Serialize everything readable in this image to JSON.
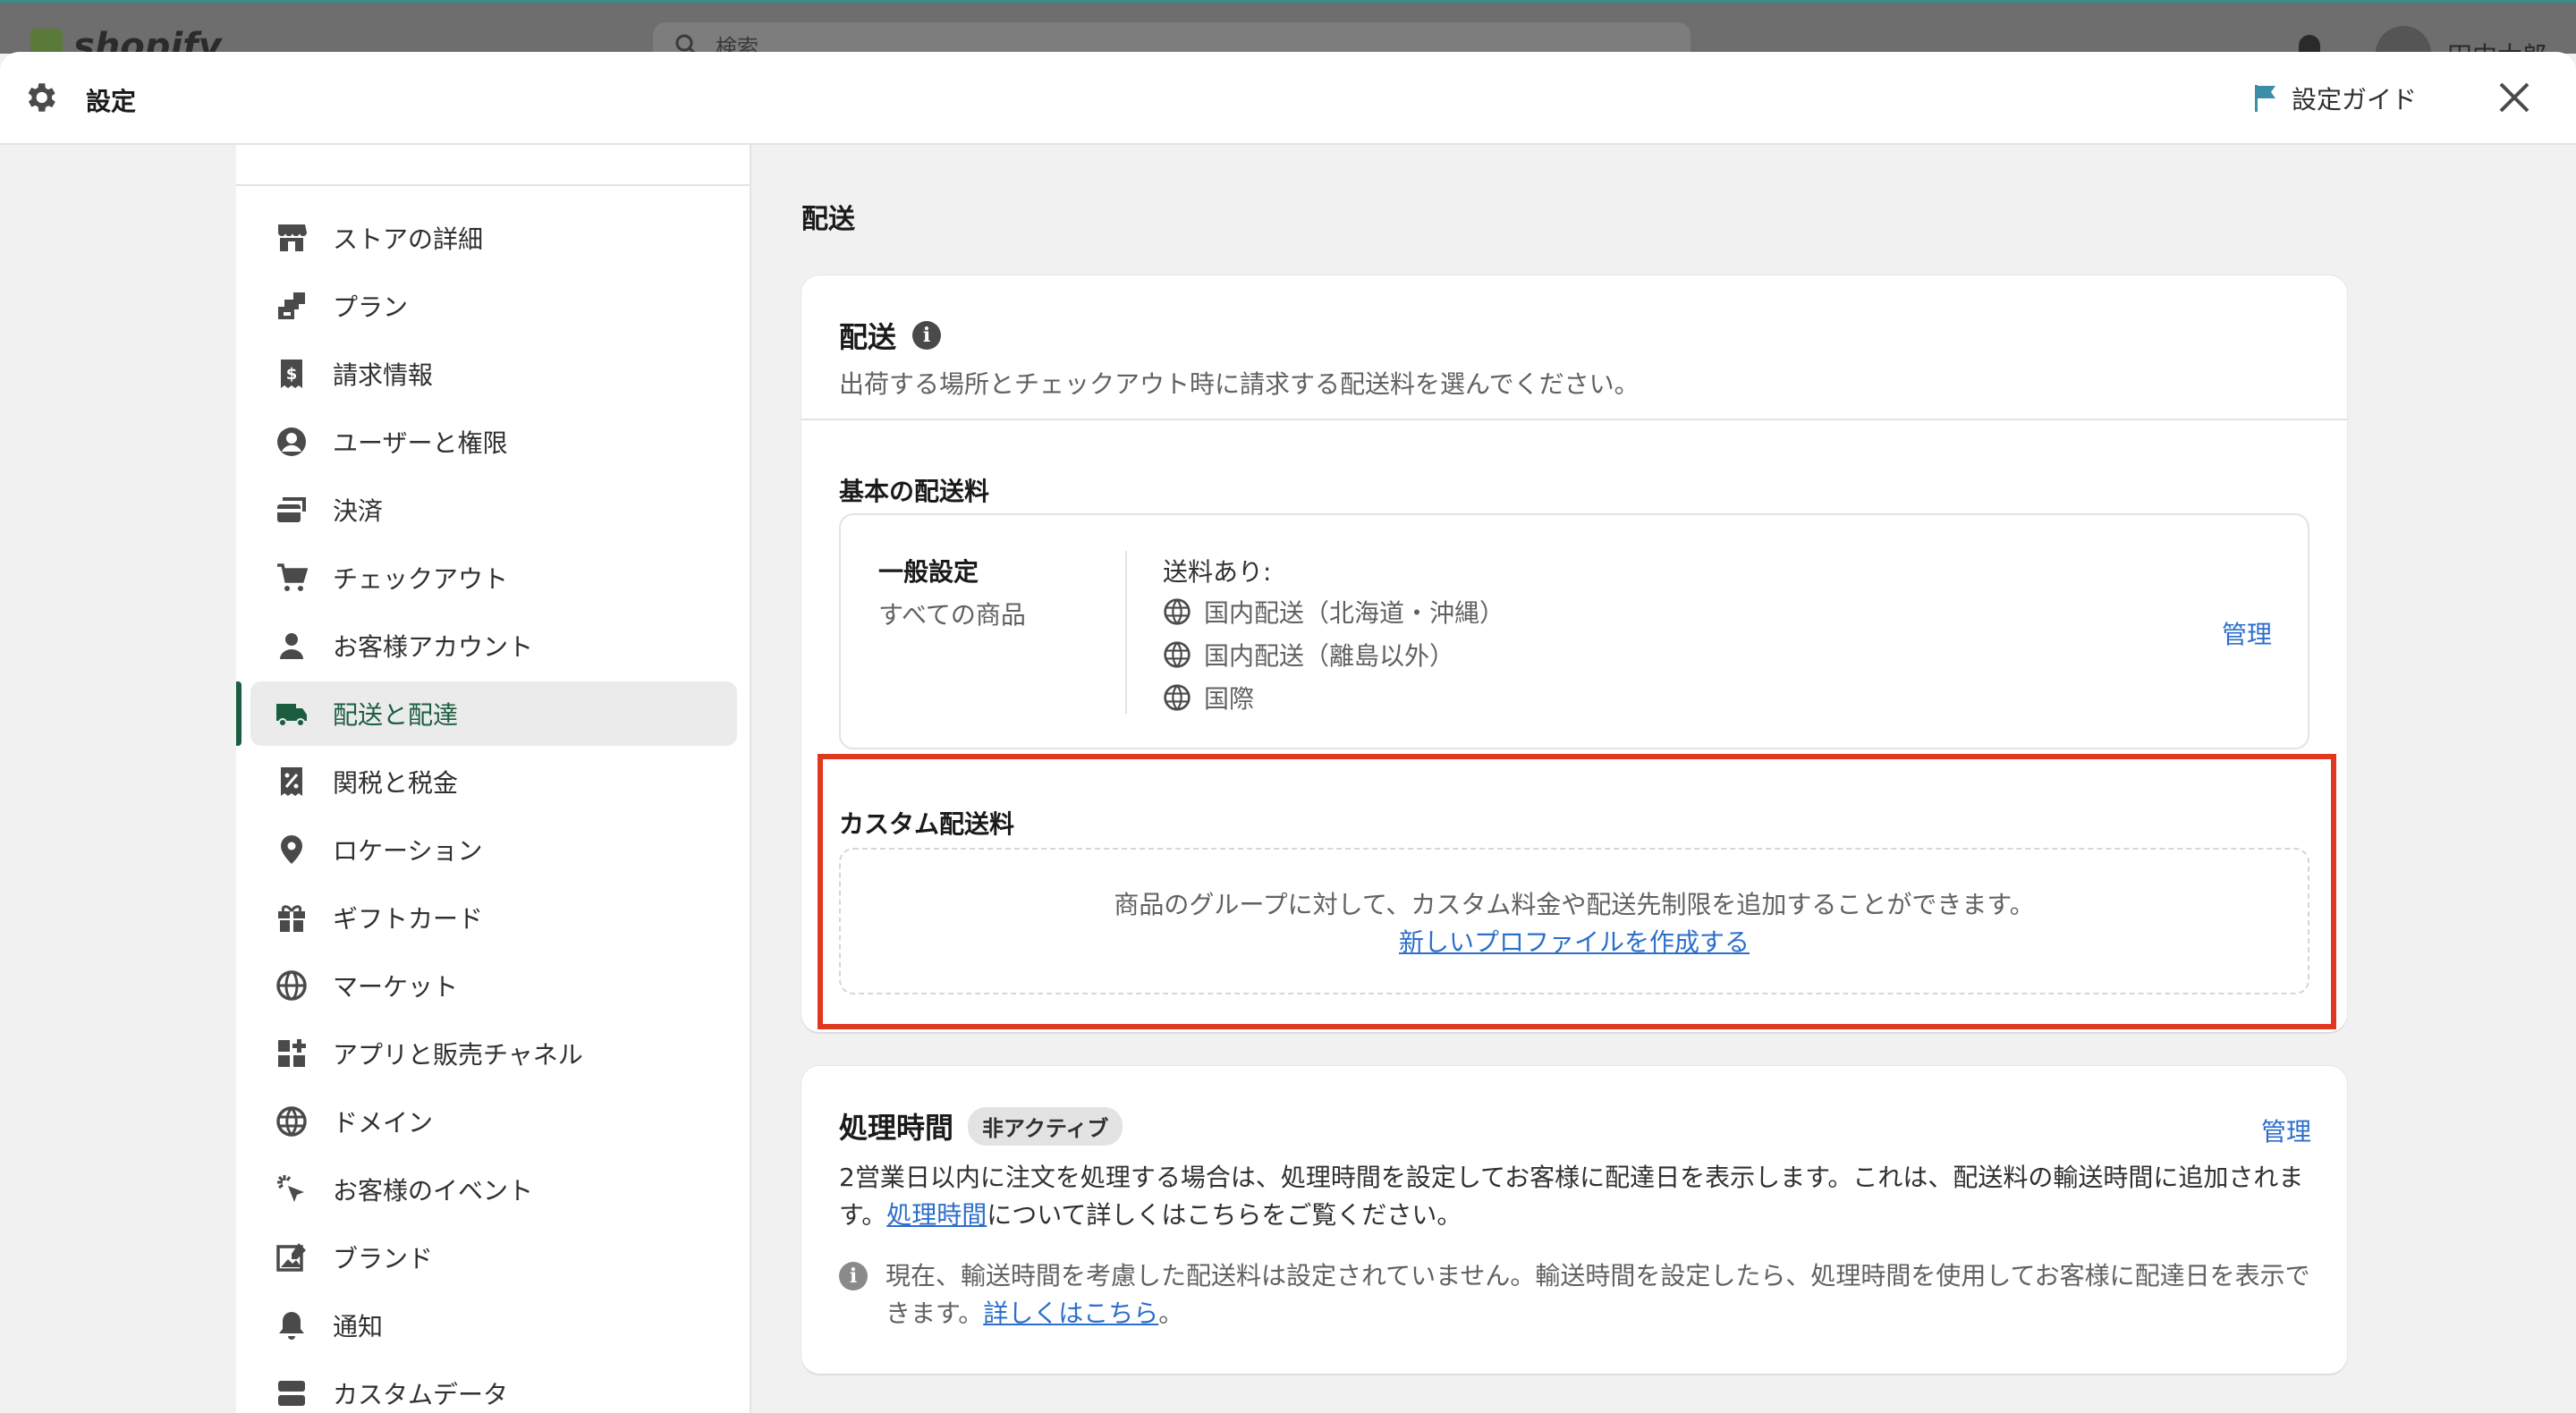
{
  "background": {
    "brand": "shopify",
    "search_placeholder": "検索",
    "user_name": "田中太郎"
  },
  "header": {
    "title": "設定",
    "guide_label": "設定ガイド",
    "icons": {
      "settings": "gear-icon",
      "guide": "flag-icon",
      "close": "close-icon"
    }
  },
  "sidebar": {
    "items": [
      {
        "label": "ストアの詳細",
        "icon": "store-icon"
      },
      {
        "label": "プラン",
        "icon": "plan-icon"
      },
      {
        "label": "請求情報",
        "icon": "billing-icon"
      },
      {
        "label": "ユーザーと権限",
        "icon": "user-circle-icon"
      },
      {
        "label": "決済",
        "icon": "payments-icon"
      },
      {
        "label": "チェックアウト",
        "icon": "cart-icon"
      },
      {
        "label": "お客様アカウント",
        "icon": "person-icon"
      },
      {
        "label": "配送と配達",
        "icon": "truck-icon",
        "active": true
      },
      {
        "label": "関税と税金",
        "icon": "tax-icon"
      },
      {
        "label": "ロケーション",
        "icon": "location-pin-icon"
      },
      {
        "label": "ギフトカード",
        "icon": "gift-icon"
      },
      {
        "label": "マーケット",
        "icon": "globe-market-icon"
      },
      {
        "label": "アプリと販売チャネル",
        "icon": "apps-icon"
      },
      {
        "label": "ドメイン",
        "icon": "globe-icon"
      },
      {
        "label": "お客様のイベント",
        "icon": "cursor-click-icon"
      },
      {
        "label": "ブランド",
        "icon": "brand-icon"
      },
      {
        "label": "通知",
        "icon": "bell-icon"
      },
      {
        "label": "カスタムデータ",
        "icon": "database-icon"
      }
    ]
  },
  "main": {
    "page_title": "配送",
    "shipping_card": {
      "title": "配送",
      "subtitle": "出荷する場所とチェックアウト時に請求する配送料を選んでください。",
      "general_rates_label": "基本の配送料",
      "profile": {
        "name": "一般設定",
        "scope": "すべての商品",
        "rates_title": "送料あり:",
        "zones": [
          "国内配送（北海道・沖縄）",
          "国内配送（離島以外）",
          "国際"
        ],
        "manage_label": "管理"
      },
      "custom_rates_label": "カスタム配送料",
      "custom_text": "商品のグループに対して、カスタム料金や配送先制限を追加することができます。",
      "custom_link": "新しいプロファイルを作成する"
    },
    "processing_card": {
      "title": "処理時間",
      "badge": "非アクティブ",
      "manage_label": "管理",
      "desc_before": "2営業日以内に注文を処理する場合は、処理時間を設定してお客様に配達日を表示します。これは、配送料の輸送時間に追加されます。",
      "desc_link": "処理時間",
      "desc_after": "について詳しくはこちらをご覧ください。",
      "note_before": "現在、輸送時間を考慮した配送料は設定されていません。輸送時間を設定したら、処理時間を使用してお客様に配達日を表示できます。",
      "note_link": "詳しくはこちら",
      "note_after": "。"
    }
  },
  "colors": {
    "accent_link": "#2c6ecb",
    "active_nav": "#1b5e3f",
    "highlight_border": "#e0371e"
  }
}
